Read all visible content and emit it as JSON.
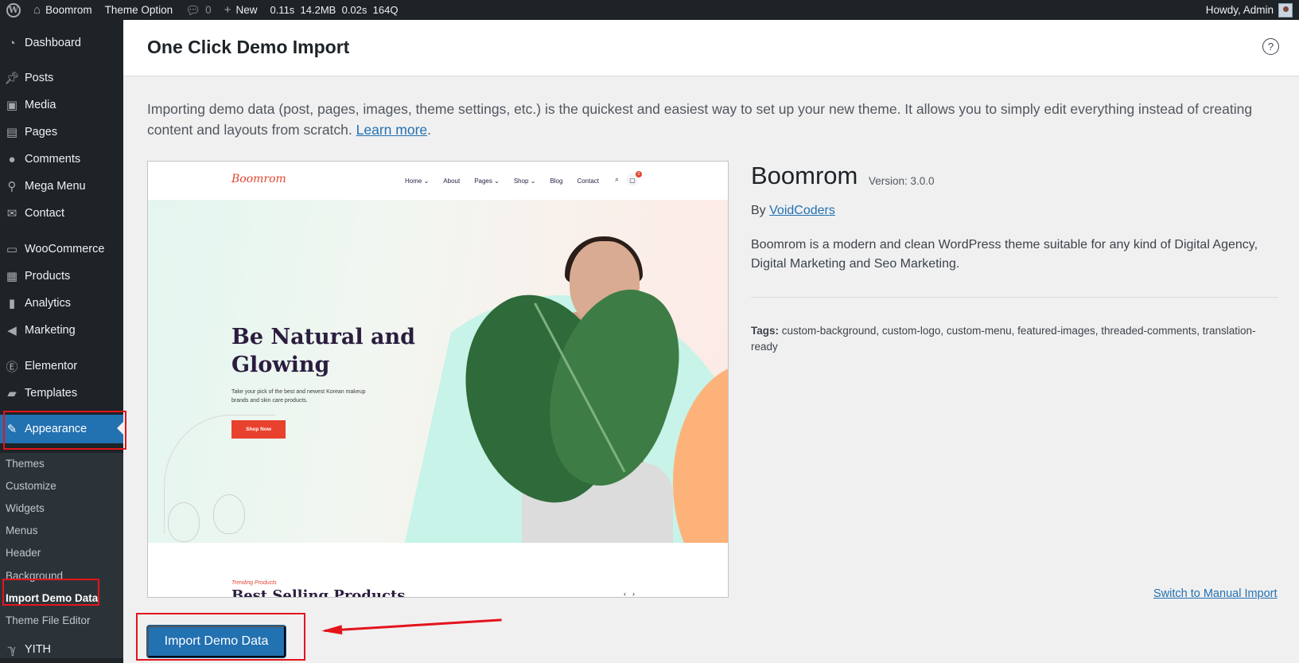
{
  "adminbar": {
    "site_name": "Boomrom",
    "theme_option": "Theme Option",
    "comments_count": "0",
    "new_label": "New",
    "perf": [
      "0.11s",
      "14.2MB",
      "0.02s",
      "164Q"
    ],
    "howdy": "Howdy, Admin"
  },
  "sidebar": {
    "items": [
      {
        "label": "Dashboard",
        "icon": "dashboard-icon"
      },
      {
        "label": "Posts",
        "icon": "pin-icon"
      },
      {
        "label": "Media",
        "icon": "media-icon"
      },
      {
        "label": "Pages",
        "icon": "pages-icon"
      },
      {
        "label": "Comments",
        "icon": "comment-icon"
      },
      {
        "label": "Mega Menu",
        "icon": "mega-menu-icon"
      },
      {
        "label": "Contact",
        "icon": "mail-icon"
      },
      {
        "label": "WooCommerce",
        "icon": "woo-icon"
      },
      {
        "label": "Products",
        "icon": "archive-icon"
      },
      {
        "label": "Analytics",
        "icon": "bar-chart-icon"
      },
      {
        "label": "Marketing",
        "icon": "megaphone-icon"
      },
      {
        "label": "Elementor",
        "icon": "elementor-icon"
      },
      {
        "label": "Templates",
        "icon": "folder-icon"
      },
      {
        "label": "Appearance",
        "icon": "paintbrush-icon"
      },
      {
        "label": "YITH",
        "icon": "yith-icon"
      }
    ],
    "submenu": [
      "Themes",
      "Customize",
      "Widgets",
      "Menus",
      "Header",
      "Background",
      "Import Demo Data",
      "Theme File Editor"
    ]
  },
  "header": {
    "title": "One Click Demo Import"
  },
  "intro": {
    "text": "Importing demo data (post, pages, images, theme settings, etc.) is the quickest and easiest way to set up your new theme. It allows you to simply edit everything instead of creating content and layouts from scratch.",
    "link": "Learn more",
    "end": "."
  },
  "preview": {
    "logo": "Boomrom",
    "menu": [
      "Home",
      "About",
      "Pages",
      "Shop",
      "Blog",
      "Contact"
    ],
    "cart_count": "0",
    "headline": "Be Natural and Glowing",
    "subtext": "Take your pick of the best and newest Korean makeup brands and skin care products.",
    "cta": "Shop Now",
    "trending": "Trending Products",
    "section_title": "Best Selling Products"
  },
  "theme": {
    "name": "Boomrom",
    "version": "Version: 3.0.0",
    "by": "By",
    "author": "VoidCoders",
    "description": "Boomrom is a modern and clean WordPress theme suitable for any kind of Digital Agency, Digital Marketing and Seo Marketing.",
    "tags_label": "Tags:",
    "tags": "custom-background, custom-logo, custom-menu, featured-images, threaded-comments, translation-ready"
  },
  "actions": {
    "switch_manual": "Switch to Manual Import",
    "import_button": "Import Demo Data"
  },
  "colors": {
    "accent": "#2271b1",
    "admin_dark": "#1d2327",
    "highlight": "#e3141b"
  }
}
